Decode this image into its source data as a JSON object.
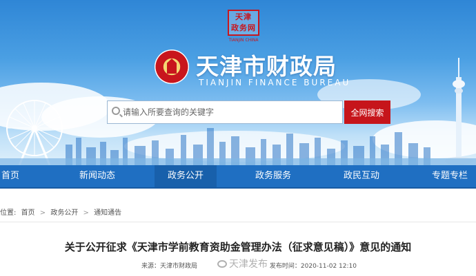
{
  "header": {
    "seal_text": "天津\n政务网",
    "seal_caption": "TIANJIN CHINA",
    "site_title": "天津市财政局",
    "site_subtitle": "TIANJIN  FINANCE  BUREAU"
  },
  "search": {
    "placeholder": "请输入所要查询的关键字",
    "button_label": "全网搜索"
  },
  "nav": {
    "items": [
      {
        "label": "首页"
      },
      {
        "label": "新闻动态"
      },
      {
        "label": "政务公开"
      },
      {
        "label": "政务服务"
      },
      {
        "label": "政民互动"
      },
      {
        "label": "专题专栏"
      }
    ],
    "active_index": 2
  },
  "breadcrumb": {
    "prefix": "位置:",
    "items": [
      "首页",
      "政务公开",
      "通知通告"
    ],
    "separator": ">"
  },
  "article": {
    "title": "关于公开征求《天津市学前教育资助金管理办法（征求意见稿）》意见的通知",
    "source": "来源：天津市财政局",
    "publish_time": "发布时间：2020-11-02 12:10"
  },
  "watermark": {
    "text": "天津发布"
  },
  "colors": {
    "nav_blue": "#1f6fc2",
    "accent_red": "#c6151b",
    "sky_top": "#2f86d6"
  }
}
